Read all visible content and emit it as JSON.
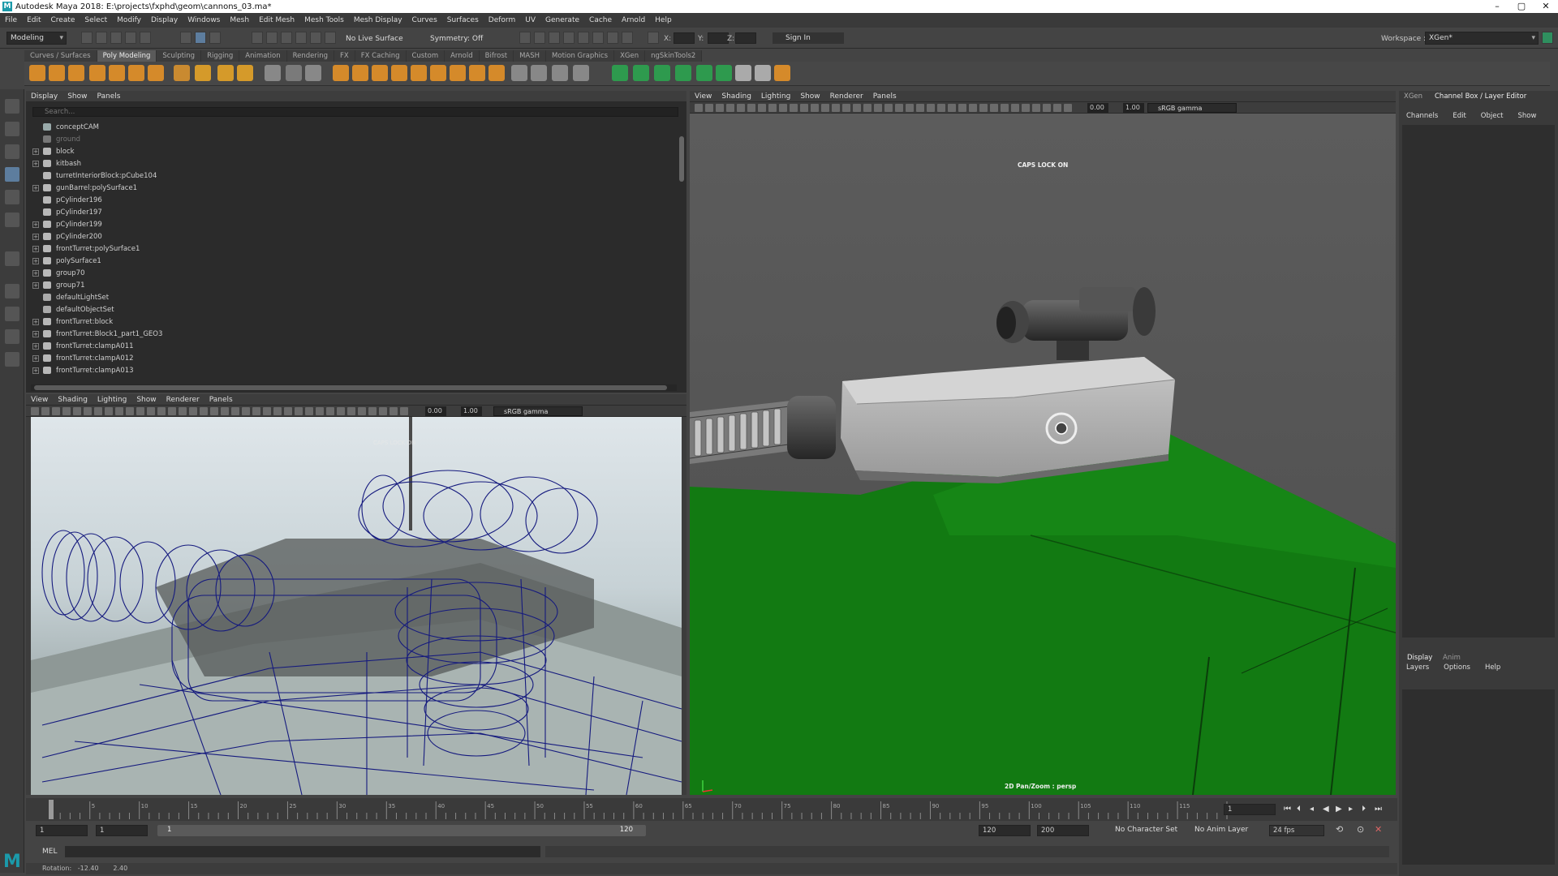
{
  "window": {
    "title": "Autodesk Maya 2018: E:\\projects\\fxphd\\geom\\cannons_03.ma*",
    "controls": [
      "–",
      "▢",
      "✕"
    ]
  },
  "menubar": [
    "File",
    "Edit",
    "Create",
    "Select",
    "Modify",
    "Display",
    "Windows",
    "Mesh",
    "Edit Mesh",
    "Mesh Tools",
    "Mesh Display",
    "Curves",
    "Surfaces",
    "Deform",
    "UV",
    "Generate",
    "Cache",
    "Arnold",
    "Help"
  ],
  "statusline": {
    "mode": "Modeling",
    "live_surface": "No Live Surface",
    "symmetry": "Symmetry: Off",
    "x_label": "X:",
    "y_label": "Y:",
    "z_label": "Z:",
    "sign_in": "Sign In",
    "workspace_label": "Workspace :",
    "workspace": "XGen*"
  },
  "shelf_tabs": [
    "Curves / Surfaces",
    "Poly Modeling",
    "Sculpting",
    "Rigging",
    "Animation",
    "Rendering",
    "FX",
    "FX Caching",
    "Custom",
    "Arnold",
    "Bifrost",
    "MASH",
    "Motion Graphics",
    "XGen",
    "ngSkinTools2"
  ],
  "shelf_active": "Poly Modeling",
  "outliner": {
    "menu": [
      "Display",
      "Show",
      "Panels"
    ],
    "search_placeholder": "Search...",
    "items": [
      {
        "name": "conceptCAM",
        "expand": false,
        "dim": false
      },
      {
        "name": "ground",
        "expand": false,
        "dim": true
      },
      {
        "name": "block",
        "expand": true,
        "dim": false
      },
      {
        "name": "kitbash",
        "expand": true,
        "dim": false
      },
      {
        "name": "turretInteriorBlock:pCube104",
        "expand": false,
        "dim": false
      },
      {
        "name": "gunBarrel:polySurface1",
        "expand": true,
        "dim": false
      },
      {
        "name": "pCylinder196",
        "expand": false,
        "dim": false
      },
      {
        "name": "pCylinder197",
        "expand": false,
        "dim": false
      },
      {
        "name": "pCylinder199",
        "expand": true,
        "dim": false
      },
      {
        "name": "pCylinder200",
        "expand": true,
        "dim": false
      },
      {
        "name": "frontTurret:polySurface1",
        "expand": true,
        "dim": false
      },
      {
        "name": "polySurface1",
        "expand": true,
        "dim": false
      },
      {
        "name": "group70",
        "expand": true,
        "dim": false
      },
      {
        "name": "group71",
        "expand": true,
        "dim": false
      },
      {
        "name": "defaultLightSet",
        "expand": false,
        "dim": false
      },
      {
        "name": "defaultObjectSet",
        "expand": false,
        "dim": false
      },
      {
        "name": "frontTurret:block",
        "expand": true,
        "dim": false
      },
      {
        "name": "frontTurret:Block1_part1_GEO3",
        "expand": true,
        "dim": false
      },
      {
        "name": "frontTurret:clampA011",
        "expand": true,
        "dim": false
      },
      {
        "name": "frontTurret:clampA012",
        "expand": true,
        "dim": false
      },
      {
        "name": "frontTurret:clampA013",
        "expand": true,
        "dim": false
      }
    ]
  },
  "viewport_bottom": {
    "menu": [
      "View",
      "Shading",
      "Lighting",
      "Show",
      "Renderer",
      "Panels"
    ],
    "exposure": "0.00",
    "gamma": "1.00",
    "colorspace": "sRGB gamma",
    "hud": "CAPS LOCK ON"
  },
  "viewport_main": {
    "menu": [
      "View",
      "Shading",
      "Lighting",
      "Show",
      "Renderer",
      "Panels"
    ],
    "exposure": "0.00",
    "gamma": "1.00",
    "colorspace": "sRGB gamma",
    "hud": "CAPS LOCK ON",
    "camera_hud": "2D Pan/Zoom : persp"
  },
  "channel_box": {
    "tabs": [
      "XGen",
      "Channel Box / Layer Editor"
    ],
    "menu": [
      "Channels",
      "Edit",
      "Object",
      "Show"
    ],
    "layer_tabs": [
      "Display",
      "Anim"
    ],
    "layer_menu": [
      "Layers",
      "Options",
      "Help"
    ]
  },
  "timeline": {
    "ticks": [
      "5",
      "10",
      "15",
      "20",
      "25",
      "30",
      "35",
      "40",
      "45",
      "50",
      "55",
      "60",
      "65",
      "70",
      "75",
      "80",
      "85",
      "90",
      "95",
      "100",
      "105",
      "110",
      "115",
      "120"
    ],
    "current_frame": "1",
    "range_start": "1",
    "anim_start": "1",
    "range_bar_start": "1",
    "range_bar_end": "120",
    "range_end": "120",
    "anim_end": "200",
    "character_set": "No Character Set",
    "anim_layer": "No Anim Layer",
    "fps": "24 fps"
  },
  "command_line": {
    "label": "MEL"
  },
  "help_line": {
    "text": "Rotation:   -12.40       2.40"
  },
  "colors": {
    "viewport_green": "#127a12",
    "viewport_grey": "#5a5a5a",
    "wire_blue": "#151a7e",
    "accent": "#5d7d9e"
  }
}
